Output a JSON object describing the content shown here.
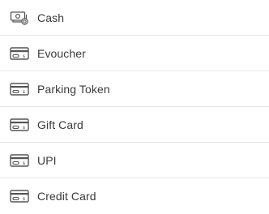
{
  "payment_methods": {
    "items": [
      {
        "label": "Cash",
        "icon": "cash-icon"
      },
      {
        "label": "Evoucher",
        "icon": "card-icon"
      },
      {
        "label": "Parking Token",
        "icon": "card-icon"
      },
      {
        "label": "Gift Card",
        "icon": "card-icon"
      },
      {
        "label": "UPI",
        "icon": "card-icon"
      },
      {
        "label": "Credit Card",
        "icon": "card-icon"
      }
    ]
  },
  "colors": {
    "text": "#3a3a3a",
    "icon": "#555555",
    "divider": "#e6e6e6",
    "background": "#ffffff"
  }
}
